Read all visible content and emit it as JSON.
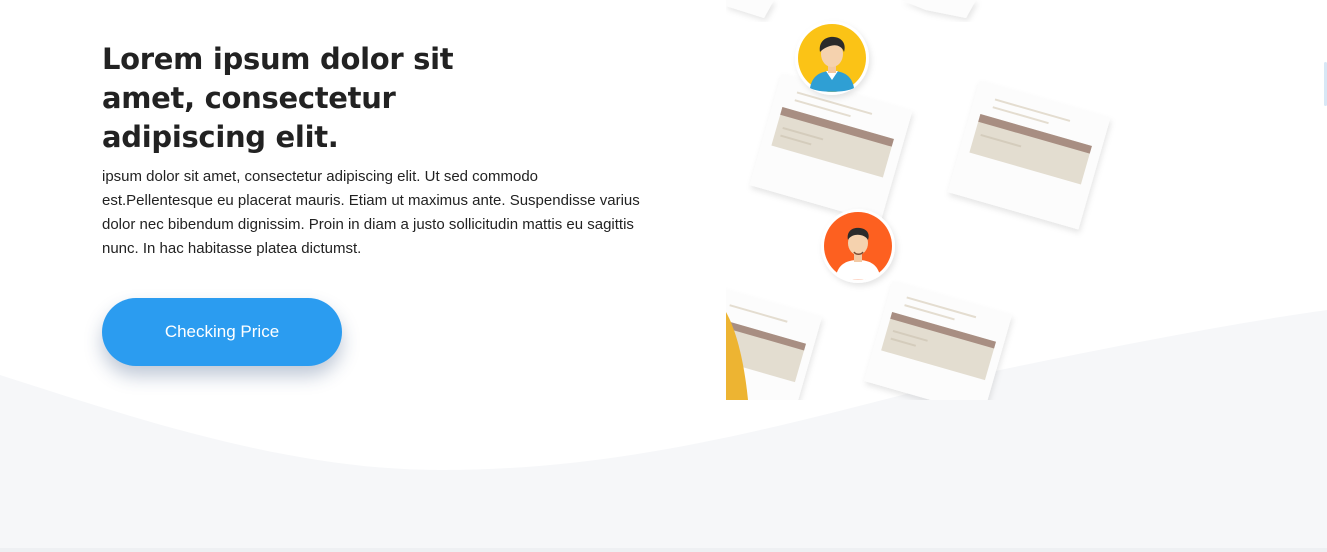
{
  "hero": {
    "title": "Lorem ipsum dolor sit amet, consectetur adipiscing elit.",
    "body": "ipsum dolor sit amet, consectetur adipiscing elit. Ut sed commodo est.Pellentesque eu placerat mauris. Etiam ut maximus ante. Suspendisse varius dolor nec bibendum dignissim. Proin in diam a justo sollicitudin mattis eu sagittis nunc. In hac habitasse platea dictumst.",
    "cta_label": "Checking Price"
  },
  "illustration": {
    "icons": [
      "document-icon",
      "person-avatar-icon"
    ]
  },
  "colors": {
    "accent": "#2b9cf0",
    "text": "#222222",
    "wave": "#f6f7f9",
    "avatar_yellow": "#fbc316",
    "avatar_orange": "#fd6020",
    "doc_band": "#e3ddd0",
    "doc_stripe": "#a88e82"
  }
}
